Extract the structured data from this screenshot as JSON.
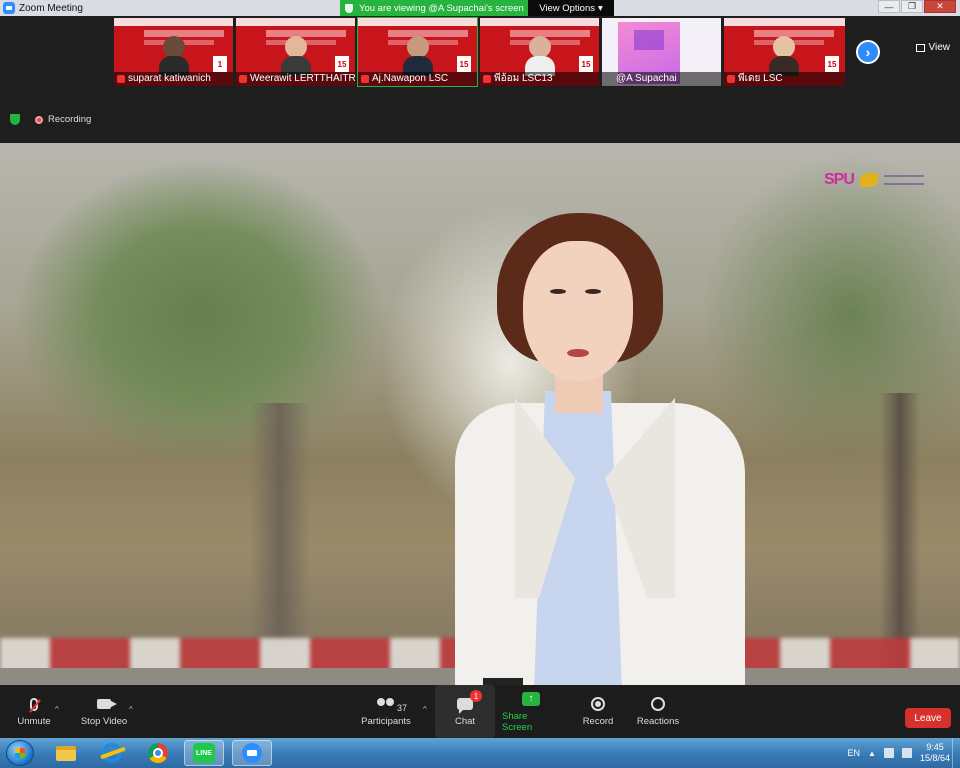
{
  "window": {
    "title": "Zoom Meeting",
    "minimize": "—",
    "restore": "❐",
    "close": "✕"
  },
  "share_banner": {
    "text": "You are viewing @A Supachai's screen",
    "view_options": "View Options",
    "view_options_caret": "▾"
  },
  "participants_strip": {
    "thumbnails": [
      {
        "name": "suparat katiwanich",
        "date": "1",
        "kind": "poster"
      },
      {
        "name": "Weerawit LERTTHAITR...",
        "date": "15",
        "kind": "poster"
      },
      {
        "name": "Aj.Nawapon LSC",
        "date": "15",
        "kind": "poster"
      },
      {
        "name": "พี่อ้อม LSC13",
        "date": "15",
        "kind": "poster"
      },
      {
        "name": "@A Supachai",
        "date": "",
        "kind": "pink"
      },
      {
        "name": "พี่เดย LSC",
        "date": "15",
        "kind": "poster"
      }
    ],
    "next_arrow": "›",
    "view_label": "View"
  },
  "status": {
    "recording_label": "Recording"
  },
  "shared_screen": {
    "logo_text": "SPU"
  },
  "controls": {
    "unmute": "Unmute",
    "stop_video": "Stop Video",
    "participants": "Participants",
    "participants_count": "37",
    "chat": "Chat",
    "chat_badge": "1",
    "share_screen": "Share Screen",
    "share_arrow": "↑",
    "record": "Record",
    "reactions": "Reactions",
    "leave": "Leave",
    "caret": "^"
  },
  "taskbar": {
    "line_label": "LINE",
    "language": "EN",
    "time": "9:45",
    "date": "15/8/64",
    "tray_arrow": "▲"
  },
  "colors": {
    "zoom_blue": "#2d8cff",
    "banner_green": "#26b33e",
    "leave_red": "#d7312b"
  }
}
